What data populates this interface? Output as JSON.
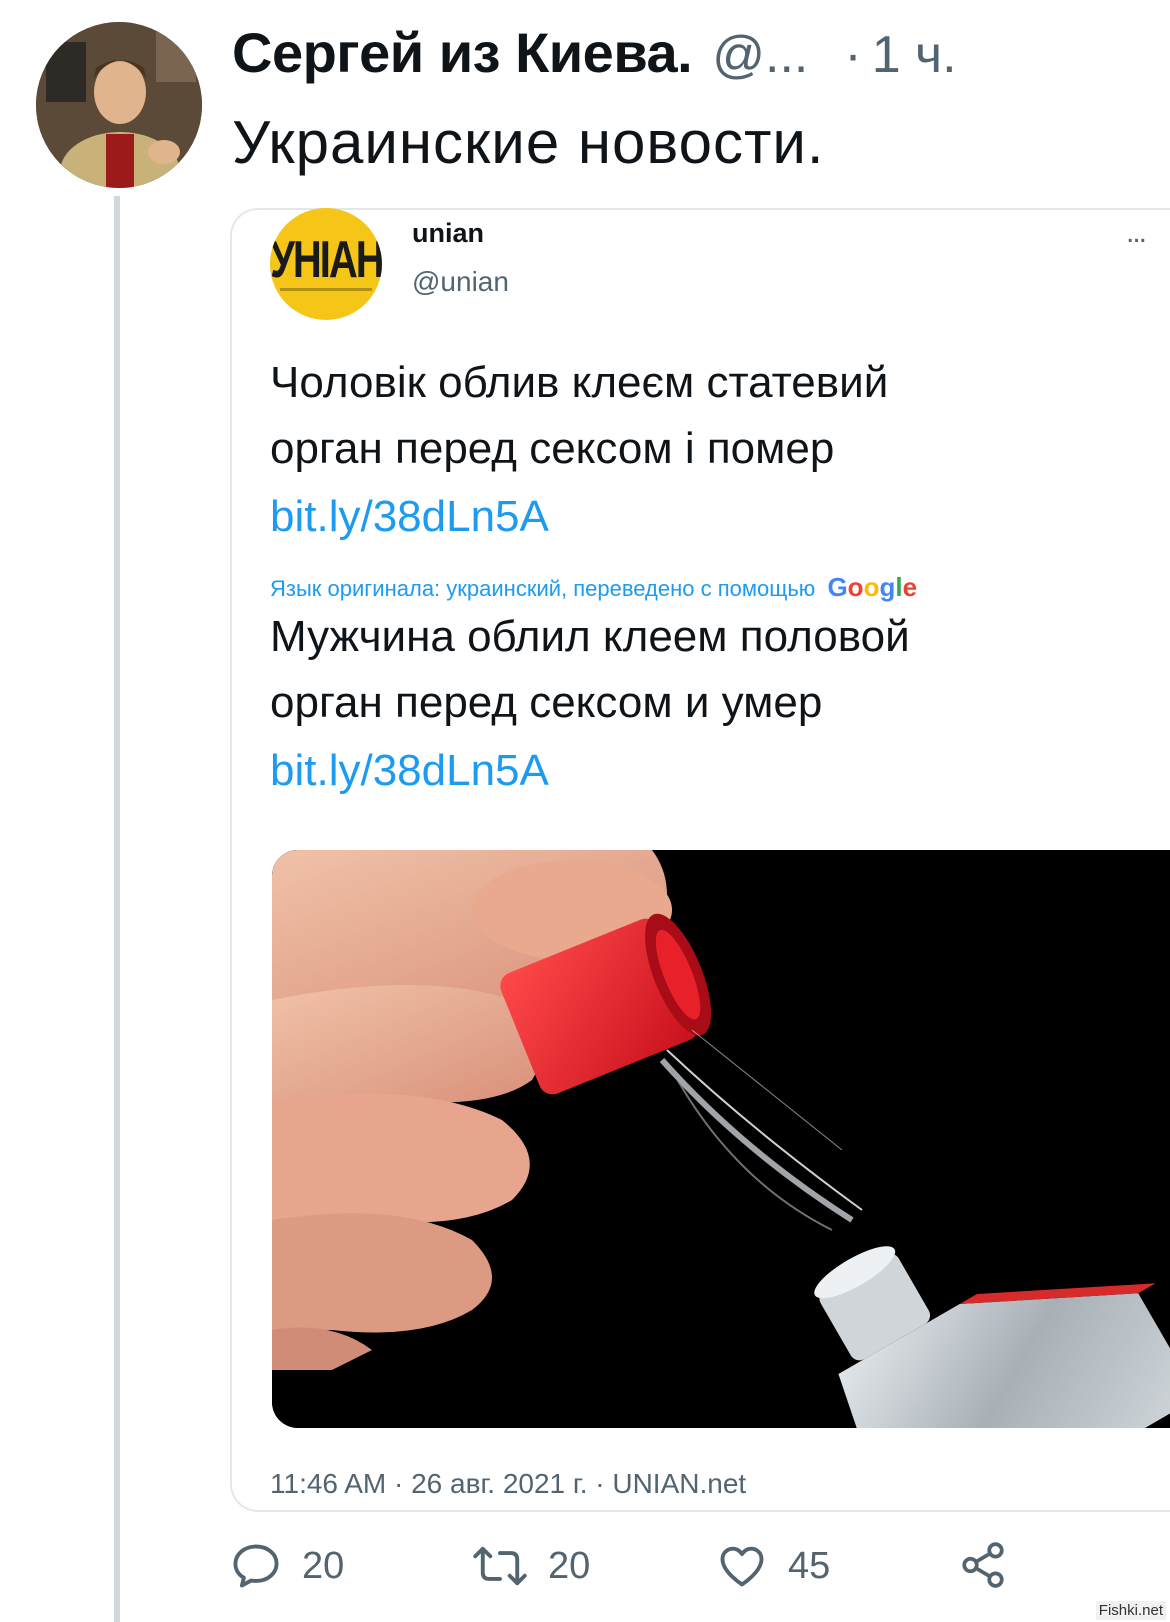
{
  "tweet": {
    "display_name": "Сергей из Киева.",
    "handle": "@...",
    "separator": "·",
    "time": "1 ч.",
    "text": "Украинские новости."
  },
  "quoted": {
    "logo_text": "УНІАН",
    "name": "unian",
    "handle": "@unian",
    "more": "...",
    "original_line1": "Чоловік облив клеєм статевий",
    "original_line2": "орган перед сексом і помер",
    "link": "bit.ly/38dLn5A",
    "translation_note": "Язык оригинала: украинский, переведено с помощью",
    "google_letters": [
      "G",
      "o",
      "o",
      "g",
      "l",
      "e"
    ],
    "translated_line1": "Мужчина облил клеем половой",
    "translated_line2": "орган перед сексом и умер",
    "translated_link": "bit.ly/38dLn5A",
    "footer": "11:46 AM · 26 авг. 2021 г. · UNIAN.net"
  },
  "actions": {
    "reply": {
      "icon": "reply-icon",
      "count": "20"
    },
    "retweet": {
      "icon": "retweet-icon",
      "count": "20"
    },
    "like": {
      "icon": "heart-icon",
      "count": "45"
    },
    "share": {
      "icon": "share-icon"
    }
  },
  "watermark": "Fishki.net",
  "colors": {
    "link": "#1d9bf0",
    "secondary": "#536471",
    "logo_bg": "#f5c518",
    "cap_red": "#e8202a"
  }
}
